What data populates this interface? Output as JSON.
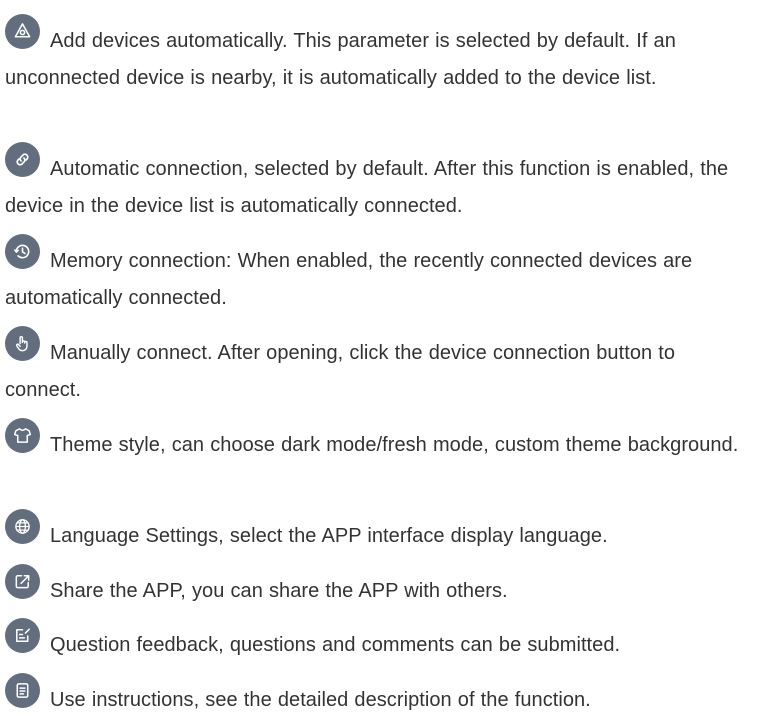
{
  "icon_color": "#626d7e",
  "text_color": "#333333",
  "items": [
    {
      "icon": "add-devices-icon",
      "text": "Add devices automatically. This parameter is selected by default. If an unconnected device is nearby, it is automatically added to the device list."
    },
    {
      "icon": "link-icon",
      "text": "Automatic connection, selected by default. After this function is enabled, the device in the device list is automatically connected."
    },
    {
      "icon": "history-clock-icon",
      "text": "Memory connection: When enabled, the recently connected devices are automatically connected."
    },
    {
      "icon": "hand-pointer-icon",
      "text": "Manually connect. After opening, click the device connection button to connect."
    },
    {
      "icon": "shirt-icon",
      "text": "Theme style, can choose dark mode/fresh mode, custom theme background."
    },
    {
      "icon": "globe-icon",
      "text": "Language Settings, select the APP interface display language."
    },
    {
      "icon": "share-icon",
      "text": "Share the APP, you can share the APP with others."
    },
    {
      "icon": "feedback-edit-icon",
      "text": "Question feedback, questions and comments can be submitted."
    },
    {
      "icon": "document-icon",
      "text": "Use instructions, see the detailed description of the function."
    }
  ]
}
